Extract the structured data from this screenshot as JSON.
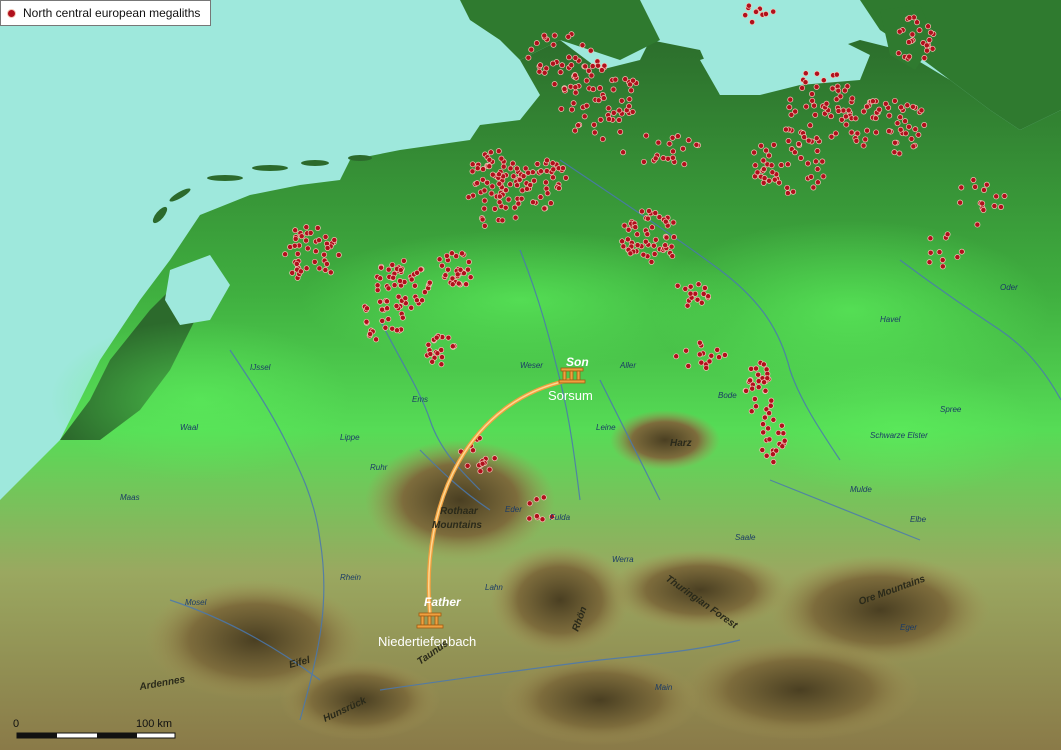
{
  "legend": {
    "label": "North central european megaliths",
    "marker_color": "#b0101c"
  },
  "sites": [
    {
      "role": "Son",
      "name": "Sorsum"
    },
    {
      "role": "Father",
      "name": "Niedertiefenbach"
    }
  ],
  "regions": {
    "harz": "Harz",
    "rothaar": "Rothaar Mountains",
    "thuringian": "Thuringian Forest",
    "ore": "Ore Mountains",
    "rhon": "Rhön",
    "eifel": "Eifel",
    "ardennes": "Ardennes",
    "hunsruck": "Hunsrück",
    "taunus": "Taunus"
  },
  "rivers": {
    "ruhr": "Ruhr",
    "ems": "Ems",
    "weser": "Weser",
    "elbe": "Elbe",
    "oder": "Oder",
    "leine": "Leine",
    "main": "Main",
    "rhein": "Rhein",
    "mosel": "Mosel",
    "saale": "Saale",
    "lippe": "Lippe",
    "eder": "Eder",
    "fulda": "Fulda",
    "werra": "Werra",
    "lahn": "Lahn",
    "mulde": "Mulde",
    "spree": "Spree",
    "havel": "Havel",
    "aller": "Aller",
    "ijssel": "IJssel",
    "maas": "Maas",
    "schwarze_elster": "Schwarze Elster",
    "eger": "Eger",
    "waal": "Waal",
    "bode": "Bode"
  },
  "scale": {
    "start": "0",
    "end": "100 km"
  },
  "colors": {
    "sea": "#9ee8dc",
    "lowland_dark": "#2f7d2f",
    "lowland_bright": "#4fe04f",
    "upland": "#8a7a48",
    "megalith": "#b0101c",
    "arc": "#f0a040"
  }
}
